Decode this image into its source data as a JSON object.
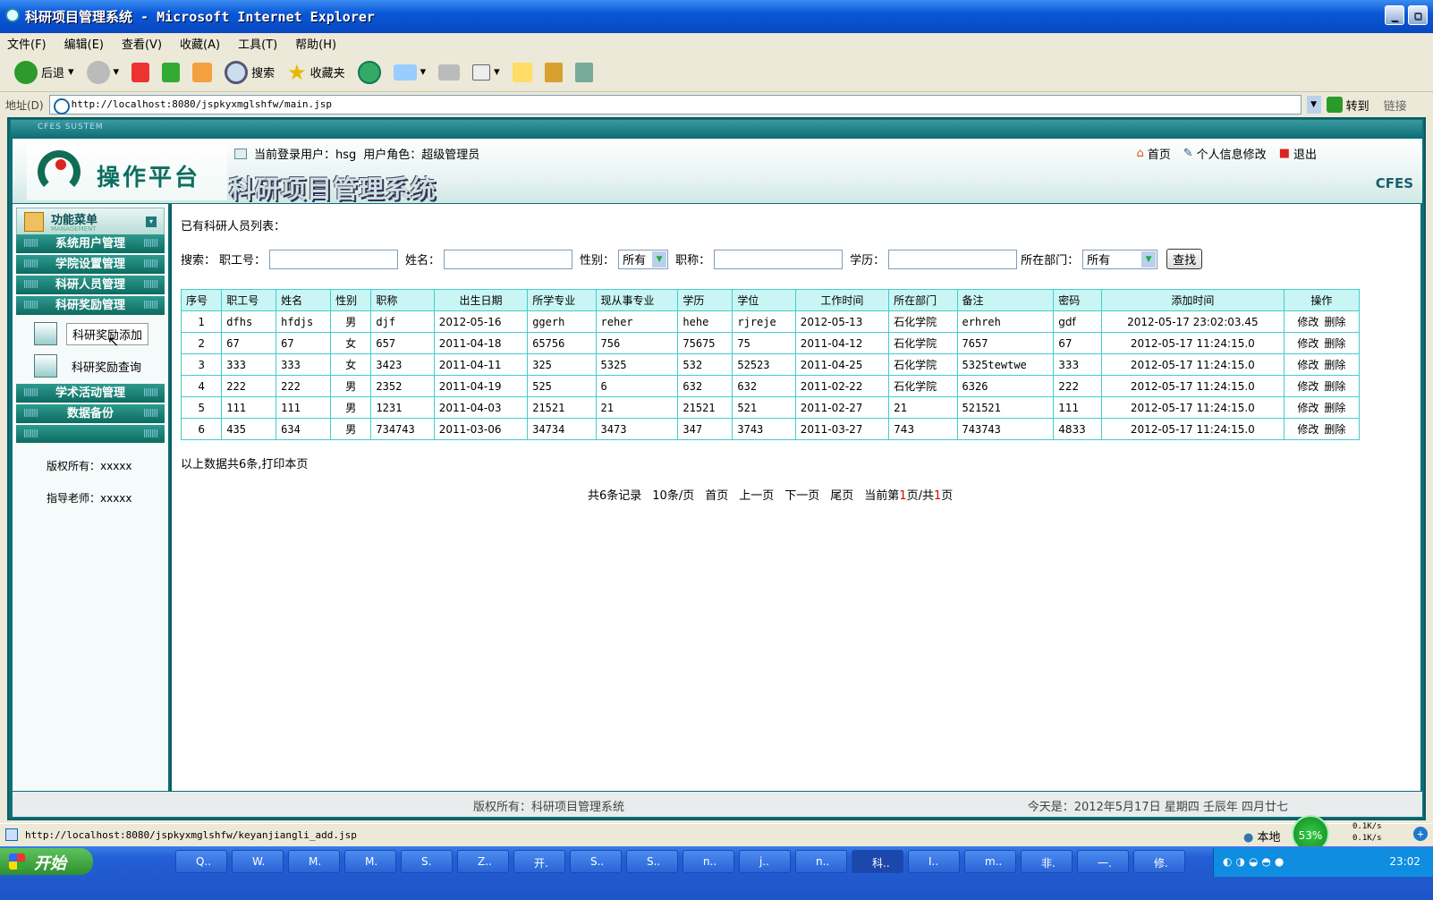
{
  "window": {
    "title": "科研项目管理系统 - Microsoft Internet Explorer"
  },
  "menubar": [
    "文件(F)",
    "编辑(E)",
    "查看(V)",
    "收藏(A)",
    "工具(T)",
    "帮助(H)"
  ],
  "toolbar": {
    "back": "后退",
    "search": "搜索",
    "favorites": "收藏夹"
  },
  "address": {
    "label": "地址(D)",
    "url": "http://localhost:8080/jspkyxmglshfw/main.jsp",
    "go": "转到",
    "links": "链接"
  },
  "app": {
    "banner_small": "CFES SUSTEM",
    "platform": "操作平台",
    "system_name": "科研项目管理系统",
    "current_user_label": "当前登录用户：hsg",
    "role_label": "用户角色：超级管理员",
    "links": {
      "home": "首页",
      "profile": "个人信息修改",
      "logout": "退出"
    },
    "brand": "CFES"
  },
  "sidebar": {
    "title": "功能菜单",
    "subtitle": "MANAGEMENT",
    "items": [
      "系统用户管理",
      "学院设置管理",
      "科研人员管理",
      "科研奖励管理"
    ],
    "subitems": [
      "科研奖励添加",
      "科研奖励查询"
    ],
    "items2": [
      "学术活动管理",
      "数据备份"
    ],
    "copyright": "版权所有：xxxxx",
    "advisor": "指导老师：xxxxx"
  },
  "main": {
    "list_title": "已有科研人员列表：",
    "search": {
      "label": "搜索：",
      "empno": "职工号：",
      "name": "姓名：",
      "gender": "性别：",
      "gender_value": "所有",
      "title": "职称：",
      "education": "学历：",
      "dept": "所在部门：",
      "dept_value": "所有",
      "button": "查找"
    },
    "columns": [
      "序号",
      "职工号",
      "姓名",
      "性别",
      "职称",
      "出生日期",
      "所学专业",
      "现从事专业",
      "学历",
      "学位",
      "工作时间",
      "所在部门",
      "备注",
      "密码",
      "添加时间",
      "操作"
    ],
    "rows": [
      [
        "1",
        "dfhs",
        "hfdjs",
        "男",
        "djf",
        "2012-05-16",
        "ggerh",
        "reher",
        "hehe",
        "rjreje",
        "2012-05-13",
        "石化学院",
        "erhreh",
        "gdf",
        "2012-05-17 23:02:03.45"
      ],
      [
        "2",
        "67",
        "67",
        "女",
        "657",
        "2011-04-18",
        "65756",
        "756",
        "75675",
        "75",
        "2011-04-12",
        "石化学院",
        "7657",
        "67",
        "2012-05-17 11:24:15.0"
      ],
      [
        "3",
        "333",
        "333",
        "女",
        "3423",
        "2011-04-11",
        "325",
        "5325",
        "532",
        "52523",
        "2011-04-25",
        "石化学院",
        "5325tewtwe",
        "333",
        "2012-05-17 11:24:15.0"
      ],
      [
        "4",
        "222",
        "222",
        "男",
        "2352",
        "2011-04-19",
        "525",
        "6",
        "632",
        "632",
        "2011-02-22",
        "石化学院",
        "6326",
        "222",
        "2012-05-17 11:24:15.0"
      ],
      [
        "5",
        "111",
        "111",
        "男",
        "1231",
        "2011-04-03",
        "21521",
        "21",
        "21521",
        "521",
        "2011-02-27",
        "21",
        "521521",
        "111",
        "2012-05-17 11:24:15.0"
      ],
      [
        "6",
        "435",
        "634",
        "男",
        "734743",
        "2011-03-06",
        "34734",
        "3473",
        "347",
        "3743",
        "2011-03-27",
        "743",
        "743743",
        "4833",
        "2012-05-17 11:24:15.0"
      ]
    ],
    "ops": {
      "edit": "修改",
      "delete": "删除"
    },
    "summary": "以上数据共6条,打印本页",
    "pager": {
      "total": "共6条记录",
      "per_page": "10条/页",
      "first": "首页",
      "prev": "上一页",
      "next": "下一页",
      "last": "尾页",
      "current_prefix": "当前第",
      "current_page": "1",
      "current_mid": "页/共",
      "total_pages": "1",
      "current_suffix": "页"
    }
  },
  "footer": {
    "copyright": "版权所有：科研项目管理系统",
    "date": "今天是：2012年5月17日 星期四 壬辰年 四月廿七"
  },
  "ie_status": {
    "url": "http://localhost:8080/jspkyxmglshfw/keyanjiangli_add.jsp",
    "zone": "本地",
    "percent": "53%",
    "up": "0.1K/s",
    "down": "0.1K/s"
  },
  "taskbar": {
    "start": "开始",
    "tasks": [
      "Q..",
      "W.",
      "M.",
      "M.",
      "S.",
      "Z..",
      "开.",
      "S..",
      "S..",
      "n..",
      "j..",
      "n..",
      "科..",
      "I..",
      "m..",
      "非.",
      "一.",
      "修."
    ],
    "clock": "23:02"
  }
}
